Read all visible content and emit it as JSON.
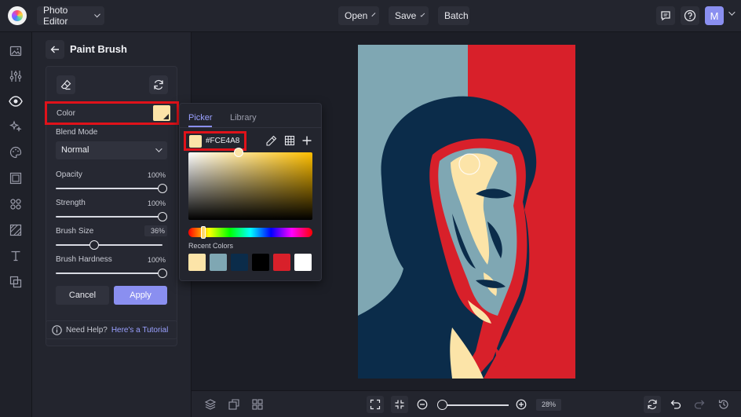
{
  "topbar": {
    "app_menu_label": "Photo Editor",
    "open_label": "Open",
    "save_label": "Save",
    "batch_label": "Batch",
    "avatar_initial": "M"
  },
  "rail": {
    "icons": [
      "image-icon",
      "adjust-sliders-icon",
      "eye-icon",
      "effects-sparkle-icon",
      "palette-icon",
      "frame-icon",
      "elements-icon",
      "texture-icon",
      "text-icon",
      "overlay-icon"
    ],
    "active": "eye-icon"
  },
  "panel": {
    "title": "Paint Brush",
    "color_label": "Color",
    "color_value": "#FCE4A8",
    "blend_mode_label": "Blend Mode",
    "blend_mode_value": "Normal",
    "opacity_label": "Opacity",
    "opacity_value": "100%",
    "opacity_level": 1.0,
    "strength_label": "Strength",
    "strength_value": "100%",
    "strength_level": 1.0,
    "brush_size_label": "Brush Size",
    "brush_size_value": "36%",
    "brush_size_level": 0.36,
    "brush_hardness_label": "Brush Hardness",
    "brush_hardness_value": "100%",
    "brush_hardness_level": 1.0,
    "cancel_label": "Cancel",
    "apply_label": "Apply",
    "help_text": "Need Help?",
    "help_link": "Here's a Tutorial"
  },
  "picker": {
    "tab_picker": "Picker",
    "tab_library": "Library",
    "hex_value": "#FCE4A8",
    "recent_label": "Recent Colors",
    "recent_colors": [
      "#fce4a8",
      "#7fa7b3",
      "#0b2c4a",
      "#000000",
      "#d8202a",
      "#ffffff"
    ]
  },
  "bottombar": {
    "zoom_value": "28%"
  },
  "colors": {
    "accent": "#8a8ff0",
    "highlight_box": "#e0121a",
    "poster_red": "#d8202a",
    "poster_blue": "#0b2c4a",
    "poster_light_blue": "#7fa7b3",
    "poster_cream": "#fce4a8"
  }
}
